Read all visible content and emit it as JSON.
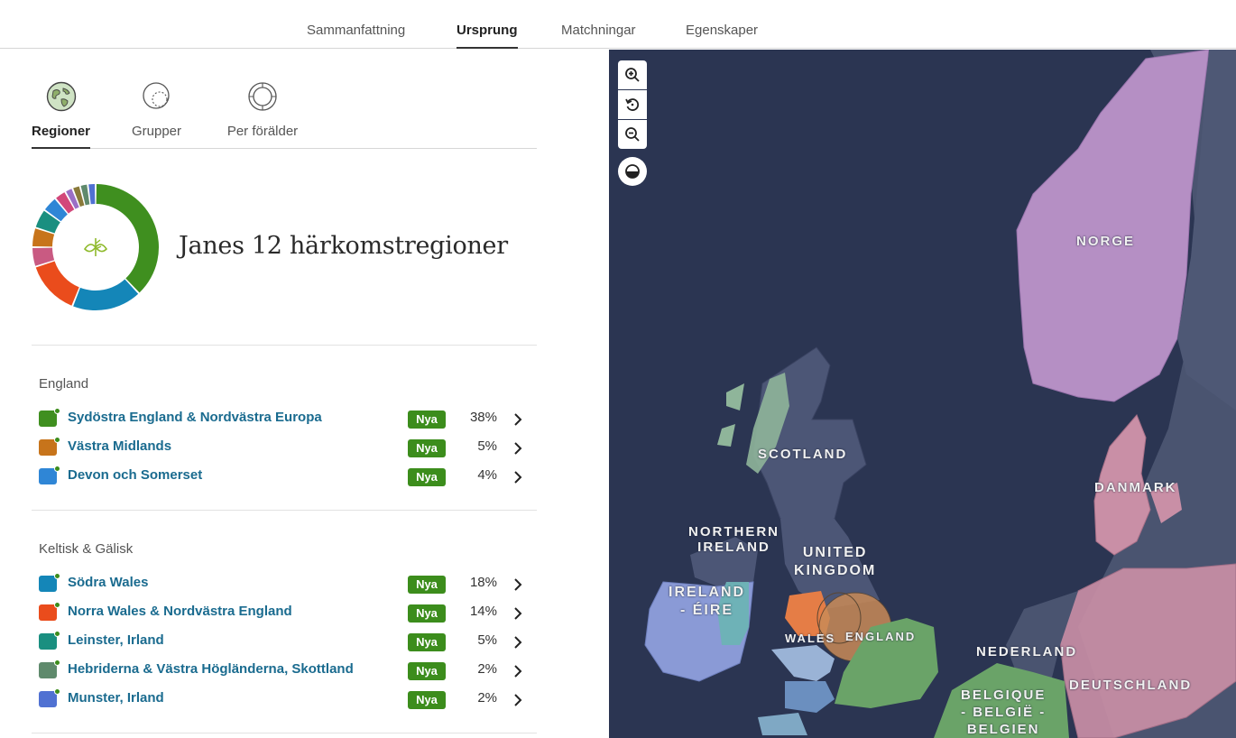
{
  "top_tabs": [
    {
      "label": "Sammanfattning",
      "active": false
    },
    {
      "label": "Ursprung",
      "active": true
    },
    {
      "label": "Matchningar",
      "active": false
    },
    {
      "label": "Egenskaper",
      "active": false
    }
  ],
  "sub_tabs": [
    {
      "label": "Regioner",
      "icon": "globe-icon",
      "active": true
    },
    {
      "label": "Grupper",
      "icon": "groups-circles-icon",
      "active": false
    },
    {
      "label": "Per förälder",
      "icon": "parent-rings-icon",
      "active": false
    }
  ],
  "summary": {
    "title": "Janes 12 härkomstregioner",
    "center_icon": "leaf-icon"
  },
  "groups": [
    {
      "title": "England",
      "regions": [
        {
          "name": "Sydöstra England & Nordvästra Europa",
          "badge": "Nya",
          "percent": "38%",
          "color": "#3f8f1f"
        },
        {
          "name": "Västra Midlands",
          "badge": "Nya",
          "percent": "5%",
          "color": "#c7741b"
        },
        {
          "name": "Devon och Somerset",
          "badge": "Nya",
          "percent": "4%",
          "color": "#2f86d6"
        }
      ]
    },
    {
      "title": "Keltisk & Gälisk",
      "regions": [
        {
          "name": "Södra Wales",
          "badge": "Nya",
          "percent": "18%",
          "color": "#1486b8"
        },
        {
          "name": "Norra Wales & Nordvästra England",
          "badge": "Nya",
          "percent": "14%",
          "color": "#ea4c1c"
        },
        {
          "name": "Leinster, Irland",
          "badge": "Nya",
          "percent": "5%",
          "color": "#1a8f80"
        },
        {
          "name": "Hebriderna & Västra Högländerna, Skottland",
          "badge": "Nya",
          "percent": "2%",
          "color": "#5f8a6c"
        },
        {
          "name": "Munster, Irland",
          "badge": "Nya",
          "percent": "2%",
          "color": "#5071d2"
        }
      ]
    }
  ],
  "donut_segments": [
    {
      "value": 38,
      "color": "#3f8f1f"
    },
    {
      "value": 18,
      "color": "#1486b8"
    },
    {
      "value": 14,
      "color": "#ea4c1c"
    },
    {
      "value": 5,
      "color": "#c95a82"
    },
    {
      "value": 5,
      "color": "#c7741b"
    },
    {
      "value": 5,
      "color": "#1a8f80"
    },
    {
      "value": 4,
      "color": "#2f86d6"
    },
    {
      "value": 3,
      "color": "#d2477a"
    },
    {
      "value": 2,
      "color": "#9b6fc6"
    },
    {
      "value": 2,
      "color": "#8a7a3a"
    },
    {
      "value": 2,
      "color": "#5f8a6c"
    },
    {
      "value": 2,
      "color": "#5071d2"
    }
  ],
  "map": {
    "controls": [
      {
        "name": "zoom-in-button",
        "icon": "zoom-in-icon"
      },
      {
        "name": "reset-view-button",
        "icon": "reset-icon"
      },
      {
        "name": "zoom-out-button",
        "icon": "zoom-out-icon"
      },
      {
        "name": "map-style-button",
        "icon": "half-circle-icon"
      }
    ],
    "labels": {
      "norge": "NORGE",
      "scotland": "SCOTLAND",
      "northern_ireland_1": "NORTHERN",
      "northern_ireland_2": "IRELAND",
      "uk_1": "UNITED",
      "uk_2": "KINGDOM",
      "ireland_1": "IRELAND",
      "ireland_2": "- ÉIRE",
      "wales": "WALES",
      "england": "ENGLAND",
      "danmark": "DANMARK",
      "nederland": "NEDERLAND",
      "belgique_1": "BELGIQUE",
      "belgique_2": "- BELGIË -",
      "belgique_3": "BELGIEN",
      "deutschland": "DEUTSCHLAND"
    }
  }
}
